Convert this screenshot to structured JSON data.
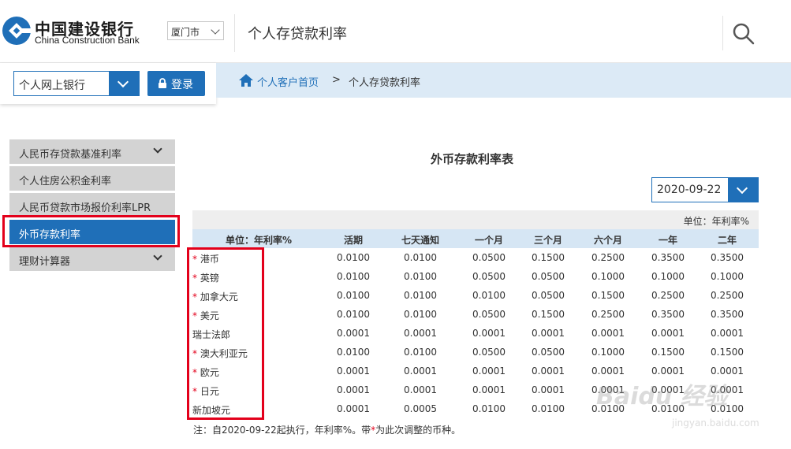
{
  "header": {
    "logo_cn": "中国建设银行",
    "logo_en": "China Construction Bank",
    "city": "厦门市",
    "title": "个人存贷款利率"
  },
  "login": {
    "bank_select": "个人网上银行",
    "login_label": "登录"
  },
  "breadcrumb": {
    "home": "个人客户首页",
    "separator": ">",
    "current": "个人存贷款利率"
  },
  "sidebar": {
    "items": [
      {
        "label": "人民币存贷款基准利率"
      },
      {
        "label": "个人住房公积金利率"
      },
      {
        "label": "人民币贷款市场报价利率LPR"
      },
      {
        "label": "外币存款利率"
      },
      {
        "label": "理财计算器"
      }
    ]
  },
  "main": {
    "title": "外币存款利率表",
    "date": "2020-09-22",
    "unit": "单位：年利率%",
    "columns": [
      "单位：年利率%",
      "活期",
      "七天通知",
      "一个月",
      "三个月",
      "六个月",
      "一年",
      "二年"
    ],
    "rows": [
      {
        "star": "*",
        "name": "港币",
        "values": [
          "0.0100",
          "0.0100",
          "0.0500",
          "0.1500",
          "0.2500",
          "0.3500",
          "0.3500"
        ]
      },
      {
        "star": "*",
        "name": "英镑",
        "values": [
          "0.0100",
          "0.0100",
          "0.0500",
          "0.0500",
          "0.1000",
          "0.1000",
          "0.1000"
        ]
      },
      {
        "star": "*",
        "name": "加拿大元",
        "values": [
          "0.0100",
          "0.0100",
          "0.0100",
          "0.0500",
          "0.1500",
          "0.2500",
          "0.2500"
        ]
      },
      {
        "star": "*",
        "name": "美元",
        "values": [
          "0.0100",
          "0.0100",
          "0.0500",
          "0.1500",
          "0.2500",
          "0.3500",
          "0.3500"
        ]
      },
      {
        "star": "",
        "name": "瑞士法郎",
        "values": [
          "0.0001",
          "0.0001",
          "0.0001",
          "0.0001",
          "0.0001",
          "0.0001",
          "0.0001"
        ]
      },
      {
        "star": "*",
        "name": "澳大利亚元",
        "values": [
          "0.0100",
          "0.0100",
          "0.0500",
          "0.0500",
          "0.1000",
          "0.1500",
          "0.1500"
        ]
      },
      {
        "star": "*",
        "name": "欧元",
        "values": [
          "0.0001",
          "0.0001",
          "0.0001",
          "0.0001",
          "0.0001",
          "0.0001",
          "0.0001"
        ]
      },
      {
        "star": "*",
        "name": "日元",
        "values": [
          "0.0001",
          "0.0001",
          "0.0001",
          "0.0001",
          "0.0001",
          "0.0001",
          "0.0001"
        ]
      },
      {
        "star": "",
        "name": "新加坡元",
        "values": [
          "0.0001",
          "0.0005",
          "0.0100",
          "0.0100",
          "0.0100",
          "0.0100",
          "0.0100"
        ]
      }
    ],
    "note_prefix": "注：自2020-09-22起执行，年利率%。带",
    "note_star": "*",
    "note_suffix": "为此次调整的币种。"
  },
  "watermark": {
    "main": "Baidu 经验",
    "sub": "jingyan.baidu.com"
  },
  "colors": {
    "brand_blue": "#1f6fb8",
    "highlight_red": "#e3001b",
    "crumb_bg": "#dceaf6",
    "table_head_bg": "#d6e6f4"
  }
}
